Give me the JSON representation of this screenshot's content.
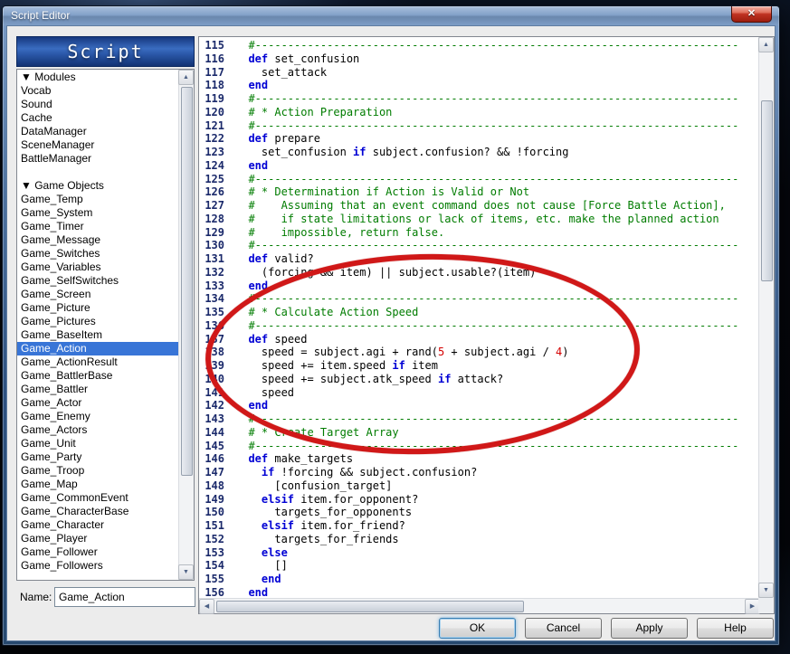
{
  "window": {
    "title": "Script Editor",
    "close_glyph": "✕"
  },
  "sidebar": {
    "header": "Script",
    "name_label": "Name:",
    "name_value": "Game_Action",
    "items": [
      {
        "label": "▼ Modules",
        "group": true
      },
      {
        "label": "Vocab"
      },
      {
        "label": "Sound"
      },
      {
        "label": "Cache"
      },
      {
        "label": "DataManager"
      },
      {
        "label": "SceneManager"
      },
      {
        "label": "BattleManager"
      },
      {
        "label": ""
      },
      {
        "label": "▼ Game Objects",
        "group": true
      },
      {
        "label": "Game_Temp"
      },
      {
        "label": "Game_System"
      },
      {
        "label": "Game_Timer"
      },
      {
        "label": "Game_Message"
      },
      {
        "label": "Game_Switches"
      },
      {
        "label": "Game_Variables"
      },
      {
        "label": "Game_SelfSwitches"
      },
      {
        "label": "Game_Screen"
      },
      {
        "label": "Game_Picture"
      },
      {
        "label": "Game_Pictures"
      },
      {
        "label": "Game_BaseItem"
      },
      {
        "label": "Game_Action",
        "selected": true
      },
      {
        "label": "Game_ActionResult"
      },
      {
        "label": "Game_BattlerBase"
      },
      {
        "label": "Game_Battler"
      },
      {
        "label": "Game_Actor"
      },
      {
        "label": "Game_Enemy"
      },
      {
        "label": "Game_Actors"
      },
      {
        "label": "Game_Unit"
      },
      {
        "label": "Game_Party"
      },
      {
        "label": "Game_Troop"
      },
      {
        "label": "Game_Map"
      },
      {
        "label": "Game_CommonEvent"
      },
      {
        "label": "Game_CharacterBase"
      },
      {
        "label": "Game_Character"
      },
      {
        "label": "Game_Player"
      },
      {
        "label": "Game_Follower"
      },
      {
        "label": "Game_Followers"
      }
    ]
  },
  "editor": {
    "lines": [
      {
        "num": 115,
        "segs": [
          [
            "c",
            "  #--------------------------------------------------------------------------"
          ]
        ]
      },
      {
        "num": 116,
        "segs": [
          [
            "p",
            "  "
          ],
          [
            "k",
            "def"
          ],
          [
            "p",
            " set_confusion"
          ]
        ]
      },
      {
        "num": 117,
        "segs": [
          [
            "p",
            "    set_attack"
          ]
        ]
      },
      {
        "num": 118,
        "segs": [
          [
            "p",
            "  "
          ],
          [
            "k",
            "end"
          ]
        ]
      },
      {
        "num": 119,
        "segs": [
          [
            "c",
            "  #--------------------------------------------------------------------------"
          ]
        ]
      },
      {
        "num": 120,
        "segs": [
          [
            "c",
            "  # * Action Preparation"
          ]
        ]
      },
      {
        "num": 121,
        "segs": [
          [
            "c",
            "  #--------------------------------------------------------------------------"
          ]
        ]
      },
      {
        "num": 122,
        "segs": [
          [
            "p",
            "  "
          ],
          [
            "k",
            "def"
          ],
          [
            "p",
            " prepare"
          ]
        ]
      },
      {
        "num": 123,
        "segs": [
          [
            "p",
            "    set_confusion "
          ],
          [
            "k",
            "if"
          ],
          [
            "p",
            " subject.confusion? && !forcing"
          ]
        ]
      },
      {
        "num": 124,
        "segs": [
          [
            "p",
            "  "
          ],
          [
            "k",
            "end"
          ]
        ]
      },
      {
        "num": 125,
        "segs": [
          [
            "c",
            "  #--------------------------------------------------------------------------"
          ]
        ]
      },
      {
        "num": 126,
        "segs": [
          [
            "c",
            "  # * Determination if Action is Valid or Not"
          ]
        ]
      },
      {
        "num": 127,
        "segs": [
          [
            "c",
            "  #    Assuming that an event command does not cause [Force Battle Action],"
          ]
        ]
      },
      {
        "num": 128,
        "segs": [
          [
            "c",
            "  #    if state limitations or lack of items, etc. make the planned action"
          ]
        ]
      },
      {
        "num": 129,
        "segs": [
          [
            "c",
            "  #    impossible, return false."
          ]
        ]
      },
      {
        "num": 130,
        "segs": [
          [
            "c",
            "  #--------------------------------------------------------------------------"
          ]
        ]
      },
      {
        "num": 131,
        "segs": [
          [
            "p",
            "  "
          ],
          [
            "k",
            "def"
          ],
          [
            "p",
            " valid?"
          ]
        ]
      },
      {
        "num": 132,
        "segs": [
          [
            "p",
            "    (forcing && item) || subject.usable?(item)"
          ]
        ]
      },
      {
        "num": 133,
        "segs": [
          [
            "p",
            "  "
          ],
          [
            "k",
            "end"
          ]
        ]
      },
      {
        "num": 134,
        "segs": [
          [
            "c",
            "  #--------------------------------------------------------------------------"
          ]
        ]
      },
      {
        "num": 135,
        "segs": [
          [
            "c",
            "  # * Calculate Action Speed"
          ]
        ]
      },
      {
        "num": 136,
        "segs": [
          [
            "c",
            "  #--------------------------------------------------------------------------"
          ]
        ]
      },
      {
        "num": 137,
        "segs": [
          [
            "p",
            "  "
          ],
          [
            "k",
            "def"
          ],
          [
            "p",
            " speed"
          ]
        ]
      },
      {
        "num": 138,
        "segs": [
          [
            "p",
            "    speed = subject.agi + rand("
          ],
          [
            "n",
            "5"
          ],
          [
            "p",
            " + subject.agi / "
          ],
          [
            "n",
            "4"
          ],
          [
            "p",
            ")"
          ]
        ]
      },
      {
        "num": 139,
        "segs": [
          [
            "p",
            "    speed += item.speed "
          ],
          [
            "k",
            "if"
          ],
          [
            "p",
            " item"
          ]
        ]
      },
      {
        "num": 140,
        "segs": [
          [
            "p",
            "    speed += subject.atk_speed "
          ],
          [
            "k",
            "if"
          ],
          [
            "p",
            " attack?"
          ]
        ]
      },
      {
        "num": 141,
        "segs": [
          [
            "p",
            "    speed"
          ]
        ]
      },
      {
        "num": 142,
        "segs": [
          [
            "p",
            "  "
          ],
          [
            "k",
            "end"
          ]
        ]
      },
      {
        "num": 143,
        "segs": [
          [
            "c",
            "  #--------------------------------------------------------------------------"
          ]
        ]
      },
      {
        "num": 144,
        "segs": [
          [
            "c",
            "  # * Create Target Array"
          ]
        ]
      },
      {
        "num": 145,
        "segs": [
          [
            "c",
            "  #--------------------------------------------------------------------------"
          ]
        ]
      },
      {
        "num": 146,
        "segs": [
          [
            "p",
            "  "
          ],
          [
            "k",
            "def"
          ],
          [
            "p",
            " make_targets"
          ]
        ]
      },
      {
        "num": 147,
        "segs": [
          [
            "p",
            "    "
          ],
          [
            "k",
            "if"
          ],
          [
            "p",
            " !forcing && subject.confusion?"
          ]
        ]
      },
      {
        "num": 148,
        "segs": [
          [
            "p",
            "      [confusion_target]"
          ]
        ]
      },
      {
        "num": 149,
        "segs": [
          [
            "p",
            "    "
          ],
          [
            "k",
            "elsif"
          ],
          [
            "p",
            " item.for_opponent?"
          ]
        ]
      },
      {
        "num": 150,
        "segs": [
          [
            "p",
            "      targets_for_opponents"
          ]
        ]
      },
      {
        "num": 151,
        "segs": [
          [
            "p",
            "    "
          ],
          [
            "k",
            "elsif"
          ],
          [
            "p",
            " item.for_friend?"
          ]
        ]
      },
      {
        "num": 152,
        "segs": [
          [
            "p",
            "      targets_for_friends"
          ]
        ]
      },
      {
        "num": 153,
        "segs": [
          [
            "p",
            "    "
          ],
          [
            "k",
            "else"
          ]
        ]
      },
      {
        "num": 154,
        "segs": [
          [
            "p",
            "      []"
          ]
        ]
      },
      {
        "num": 155,
        "segs": [
          [
            "p",
            "    "
          ],
          [
            "k",
            "end"
          ]
        ]
      },
      {
        "num": 156,
        "segs": [
          [
            "p",
            "  "
          ],
          [
            "k",
            "end"
          ]
        ]
      }
    ]
  },
  "buttons": {
    "ok": "OK",
    "cancel": "Cancel",
    "apply": "Apply",
    "help": "Help"
  },
  "annotation": {
    "shape": "ellipse",
    "color": "#d01818"
  },
  "syntax_colors": {
    "comment": "#007c00",
    "keyword": "#0000d4",
    "number": "#d40000",
    "plain": "#000000",
    "line_number": "#1b2a6b"
  }
}
